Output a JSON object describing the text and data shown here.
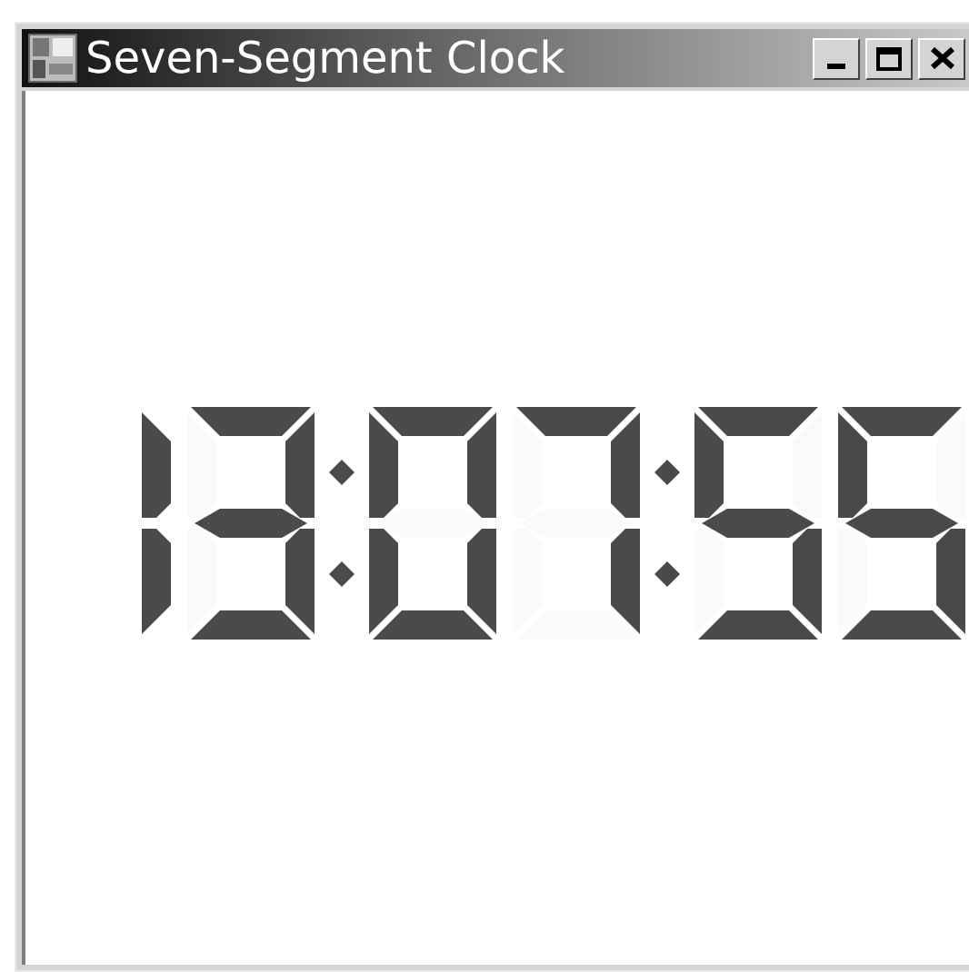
{
  "window": {
    "title": "Seven-Segment Clock"
  },
  "display": {
    "cells": [
      {
        "kind": "half_digit",
        "lit": [
          true,
          true
        ]
      },
      {
        "kind": "digit",
        "lit": [
          true,
          true,
          true,
          true,
          false,
          false,
          true
        ]
      },
      {
        "kind": "colon"
      },
      {
        "kind": "digit",
        "lit": [
          true,
          true,
          true,
          true,
          true,
          true,
          false
        ]
      },
      {
        "kind": "digit",
        "lit": [
          true,
          true,
          true,
          false,
          false,
          false,
          false
        ]
      },
      {
        "kind": "colon"
      },
      {
        "kind": "digit",
        "lit": [
          true,
          false,
          true,
          true,
          false,
          true,
          true
        ]
      },
      {
        "kind": "digit",
        "lit": [
          true,
          false,
          true,
          true,
          false,
          true,
          true
        ]
      }
    ]
  }
}
